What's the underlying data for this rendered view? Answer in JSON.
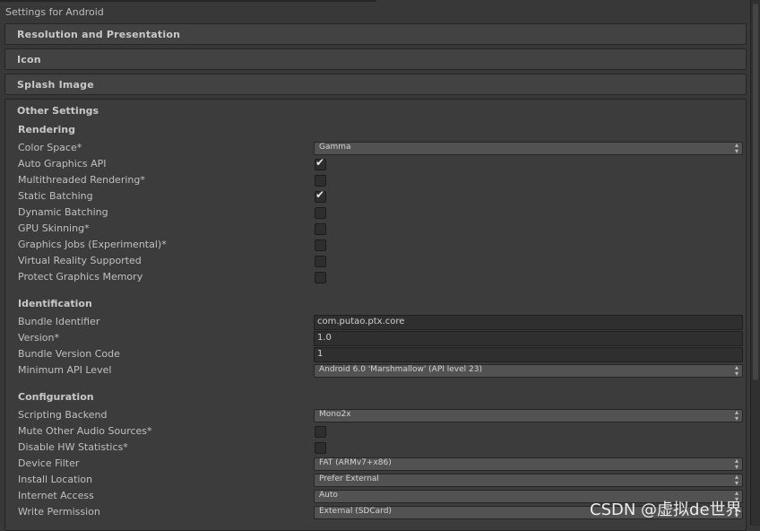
{
  "window": {
    "title": "Settings for Android"
  },
  "foldouts": {
    "resolution": "Resolution and Presentation",
    "icon": "Icon",
    "splash": "Splash Image",
    "other": "Other Settings"
  },
  "rendering": {
    "header": "Rendering",
    "color_space": {
      "label": "Color Space*",
      "value": "Gamma"
    },
    "auto_graphics_api": {
      "label": "Auto Graphics API",
      "checked": true
    },
    "multithreaded_rendering": {
      "label": "Multithreaded Rendering*",
      "checked": false
    },
    "static_batching": {
      "label": "Static Batching",
      "checked": true
    },
    "dynamic_batching": {
      "label": "Dynamic Batching",
      "checked": false
    },
    "gpu_skinning": {
      "label": "GPU Skinning*",
      "checked": false
    },
    "graphics_jobs": {
      "label": "Graphics Jobs (Experimental)*",
      "checked": false
    },
    "vr_supported": {
      "label": "Virtual Reality Supported",
      "checked": false
    },
    "protect_graphics_memory": {
      "label": "Protect Graphics Memory",
      "checked": false
    }
  },
  "identification": {
    "header": "Identification",
    "bundle_identifier": {
      "label": "Bundle Identifier",
      "value": "com.putao.ptx.core"
    },
    "version": {
      "label": "Version*",
      "value": "1.0"
    },
    "bundle_version_code": {
      "label": "Bundle Version Code",
      "value": "1"
    },
    "min_api_level": {
      "label": "Minimum API Level",
      "value": "Android 6.0 'Marshmallow' (API level 23)"
    }
  },
  "configuration": {
    "header": "Configuration",
    "scripting_backend": {
      "label": "Scripting Backend",
      "value": "Mono2x"
    },
    "mute_other_audio": {
      "label": "Mute Other Audio Sources*",
      "checked": false
    },
    "disable_hw_stats": {
      "label": "Disable HW Statistics*",
      "checked": false
    },
    "device_filter": {
      "label": "Device Filter",
      "value": "FAT (ARMv7+x86)"
    },
    "install_location": {
      "label": "Install Location",
      "value": "Prefer External"
    },
    "internet_access": {
      "label": "Internet Access",
      "value": "Auto"
    },
    "write_permission": {
      "label": "Write Permission",
      "value": "External (SDCard)"
    }
  },
  "icons": {
    "checkmark": "checkmark-icon",
    "dropdown": "dropdown-arrows-icon"
  },
  "colors": {
    "background": "#383838",
    "field": "#2f2f2f",
    "dropdown": "#525252"
  },
  "watermark": "CSDN @虚拟de世界"
}
